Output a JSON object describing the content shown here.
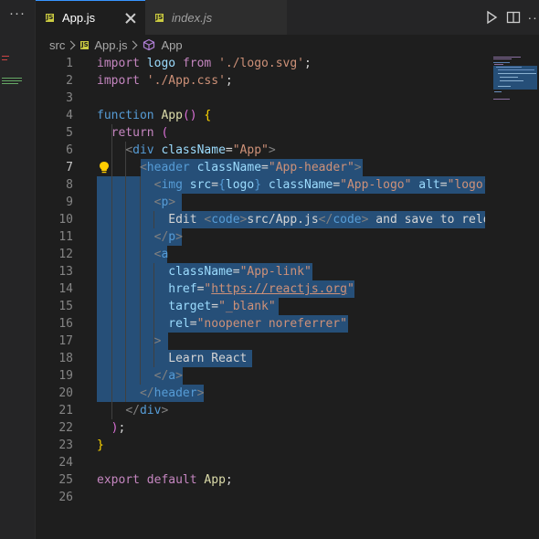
{
  "sidebar": {
    "more_label": "···"
  },
  "tabs": [
    {
      "label": "App.js",
      "icon": "js-file-icon",
      "badge": "JS",
      "active": true
    },
    {
      "label": "index.js",
      "icon": "js-file-icon",
      "badge": "JS",
      "active": false
    }
  ],
  "toolbar": {
    "more_label": "···"
  },
  "breadcrumb": {
    "folder": "src",
    "file": "App.js",
    "symbol": "App",
    "badge": "JS"
  },
  "editor": {
    "active_line": 7,
    "line_numbers": [
      "1",
      "2",
      "3",
      "4",
      "5",
      "6",
      "7",
      "8",
      "9",
      "10",
      "11",
      "12",
      "13",
      "14",
      "15",
      "16",
      "17",
      "18",
      "19",
      "20",
      "21",
      "22",
      "23",
      "24",
      "25",
      "26"
    ],
    "lines": [
      "import logo from './logo.svg';",
      "import './App.css';",
      "",
      "function App() {",
      "  return (",
      "    <div className=\"App\">",
      "      <header className=\"App-header\">",
      "        <img src={logo} className=\"App-logo\" alt=\"logo\" />",
      "        <p>",
      "          Edit <code>src/App.js</code> and save to reload.",
      "        </p>",
      "        <a",
      "          className=\"App-link\"",
      "          href=\"https://reactjs.org\"",
      "          target=\"_blank\"",
      "          rel=\"noopener noreferrer\"",
      "        >",
      "          Learn React",
      "        </a>",
      "      </header>",
      "    </div>",
      "  );",
      "}",
      "",
      "export default App;",
      ""
    ]
  },
  "colors": {
    "background": "#1e1e1e",
    "selection": "#264f78",
    "keyword": "#c586c0",
    "string": "#ce9178",
    "tag": "#569cd6",
    "attribute": "#9cdcfe",
    "function": "#dcdcaa",
    "js_badge": "#cbcb41"
  }
}
